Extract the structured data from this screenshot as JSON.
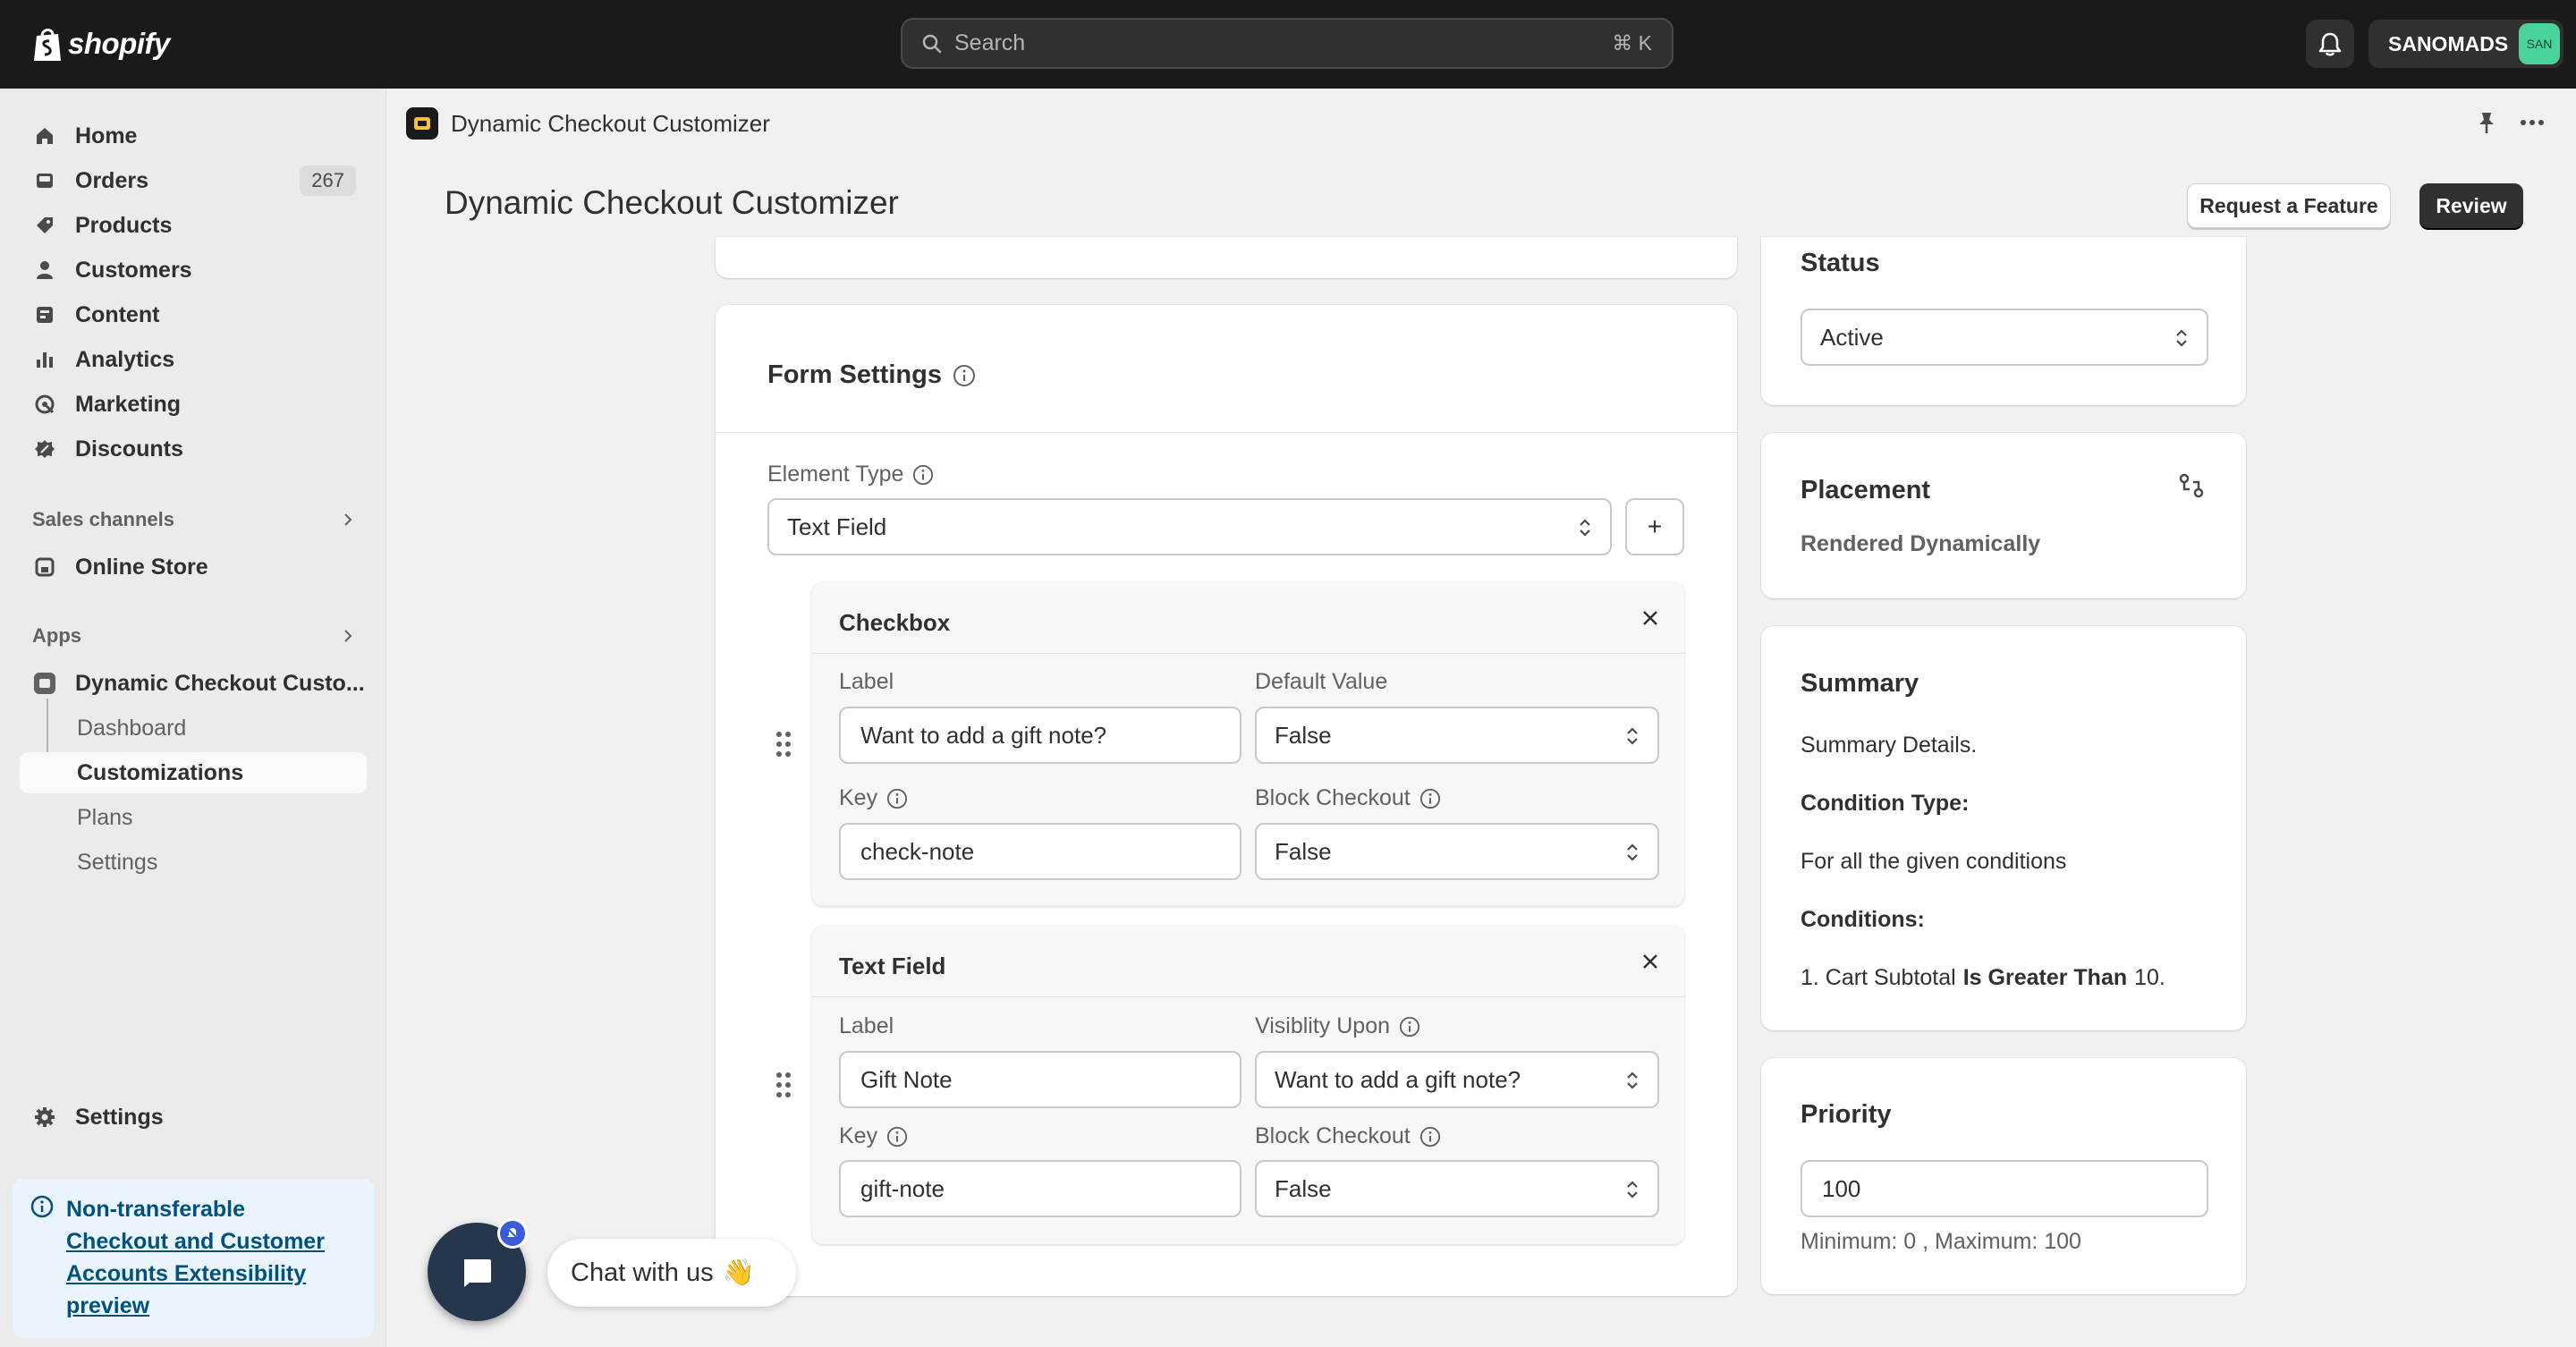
{
  "topbar": {
    "brand": "shopify",
    "search_placeholder": "Search",
    "search_shortcut": "⌘ K",
    "account_name": "SANOMADS",
    "account_initials": "SAN"
  },
  "sidebar": {
    "items": [
      {
        "label": "Home",
        "icon": "home-icon"
      },
      {
        "label": "Orders",
        "icon": "inbox-icon",
        "badge": "267"
      },
      {
        "label": "Products",
        "icon": "tag-icon"
      },
      {
        "label": "Customers",
        "icon": "person-icon"
      },
      {
        "label": "Content",
        "icon": "content-icon"
      },
      {
        "label": "Analytics",
        "icon": "bar-chart-icon"
      },
      {
        "label": "Marketing",
        "icon": "target-icon"
      },
      {
        "label": "Discounts",
        "icon": "discount-icon"
      }
    ],
    "sales_channels_label": "Sales channels",
    "online_store_label": "Online Store",
    "apps_label": "Apps",
    "app_label": "Dynamic Checkout Custo...",
    "app_subitems": [
      "Dashboard",
      "Customizations",
      "Plans",
      "Settings"
    ],
    "settings_label": "Settings",
    "banner": {
      "line1": "Non-transferable",
      "link_lines": [
        "Checkout and Customer",
        "Accounts Extensibility",
        "preview"
      ]
    }
  },
  "app_header": {
    "app_name": "Dynamic Checkout Customizer",
    "page_title": "Dynamic Checkout Customizer",
    "request_feature_label": "Request a Feature",
    "review_label": "Review"
  },
  "form_settings": {
    "title": "Form Settings",
    "element_type_label": "Element Type",
    "element_type_value": "Text Field",
    "add_label": "+",
    "checkbox_card": {
      "title": "Checkbox",
      "label_label": "Label",
      "label_value": "Want to add a gift note?",
      "default_value_label": "Default Value",
      "default_value": "False",
      "key_label": "Key",
      "key_value": "check-note",
      "block_checkout_label": "Block Checkout",
      "block_checkout_value": "False"
    },
    "text_field_card": {
      "title": "Text Field",
      "label_label": "Label",
      "label_value": "Gift Note",
      "visibility_label": "Visiblity Upon",
      "visibility_value": "Want to add a gift note?",
      "key_label": "Key",
      "key_value": "gift-note",
      "block_checkout_label": "Block Checkout",
      "block_checkout_value": "False"
    }
  },
  "status": {
    "title": "Status",
    "value": "Active"
  },
  "placement": {
    "title": "Placement",
    "value": "Rendered Dynamically"
  },
  "summary": {
    "title": "Summary",
    "details": "Summary Details.",
    "condition_type_label": "Condition Type:",
    "condition_type_value": "For all the given conditions",
    "conditions_label": "Conditions:",
    "condition_1_prefix": "1. Cart Subtotal",
    "condition_1_op": "Is Greater Than",
    "condition_1_value": "10."
  },
  "priority": {
    "title": "Priority",
    "value": "100",
    "help": "Minimum: 0 , Maximum: 100"
  },
  "chat": {
    "label": "Chat with us",
    "emoji": "👋"
  },
  "colors": {
    "topbar": "#1a1a1a",
    "accent_dark": "#303030",
    "avatar": "#4ad39a",
    "banner_bg": "#eaf4ff",
    "link": "#00527c",
    "chat_bubble": "#25364d"
  }
}
